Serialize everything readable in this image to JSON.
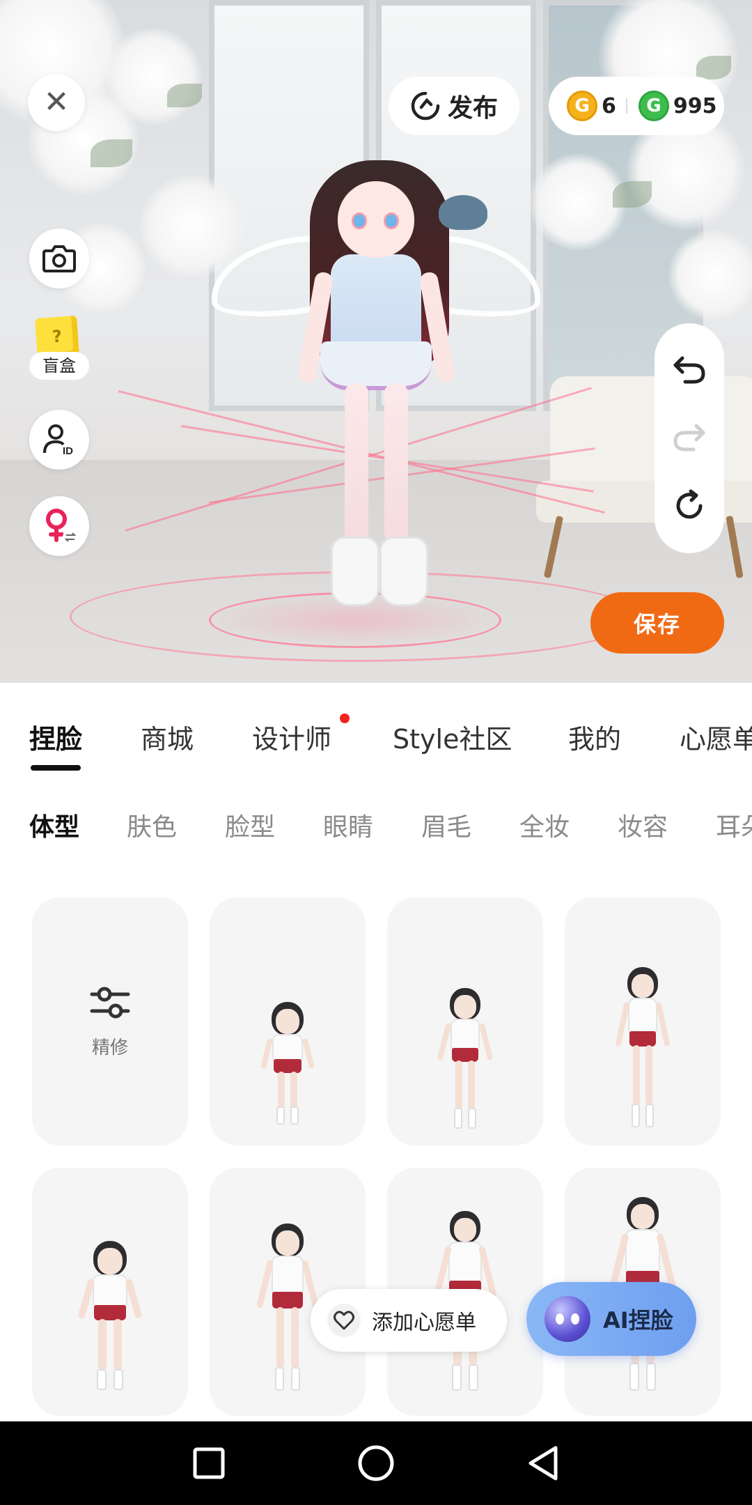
{
  "stage": {
    "publish_label": "发布",
    "wallet": {
      "gold_coins": "6",
      "green_coins": "995"
    },
    "blind_box_label": "盲盒",
    "blind_box_mark": "?",
    "save_label": "保存"
  },
  "tabs": [
    {
      "label": "捏脸",
      "active": true
    },
    {
      "label": "商城"
    },
    {
      "label": "设计师",
      "badge": true
    },
    {
      "label": "Style社区"
    },
    {
      "label": "我的"
    },
    {
      "label": "心愿单"
    }
  ],
  "subtabs": [
    {
      "label": "体型",
      "active": true
    },
    {
      "label": "肤色"
    },
    {
      "label": "脸型"
    },
    {
      "label": "眼睛"
    },
    {
      "label": "眉毛"
    },
    {
      "label": "全妆"
    },
    {
      "label": "妆容"
    },
    {
      "label": "耳朵"
    }
  ],
  "grid": {
    "refine_label": "精修"
  },
  "floating": {
    "wishlist_label": "添加心愿单",
    "ai_label": "AI捏脸"
  },
  "colors": {
    "accent_orange": "#f06a14",
    "badge_red": "#f2241e",
    "gold_coin": "#f5b21d",
    "green_coin": "#3ebd4f"
  },
  "icons": [
    "close-icon",
    "publish-icon",
    "camera-icon",
    "blind-box-icon",
    "avatar-id-icon",
    "gender-switch-icon",
    "undo-icon",
    "redo-icon",
    "reset-icon",
    "heart-icon",
    "ai-orb-icon",
    "nav-square-icon",
    "nav-circle-icon",
    "nav-back-icon"
  ]
}
